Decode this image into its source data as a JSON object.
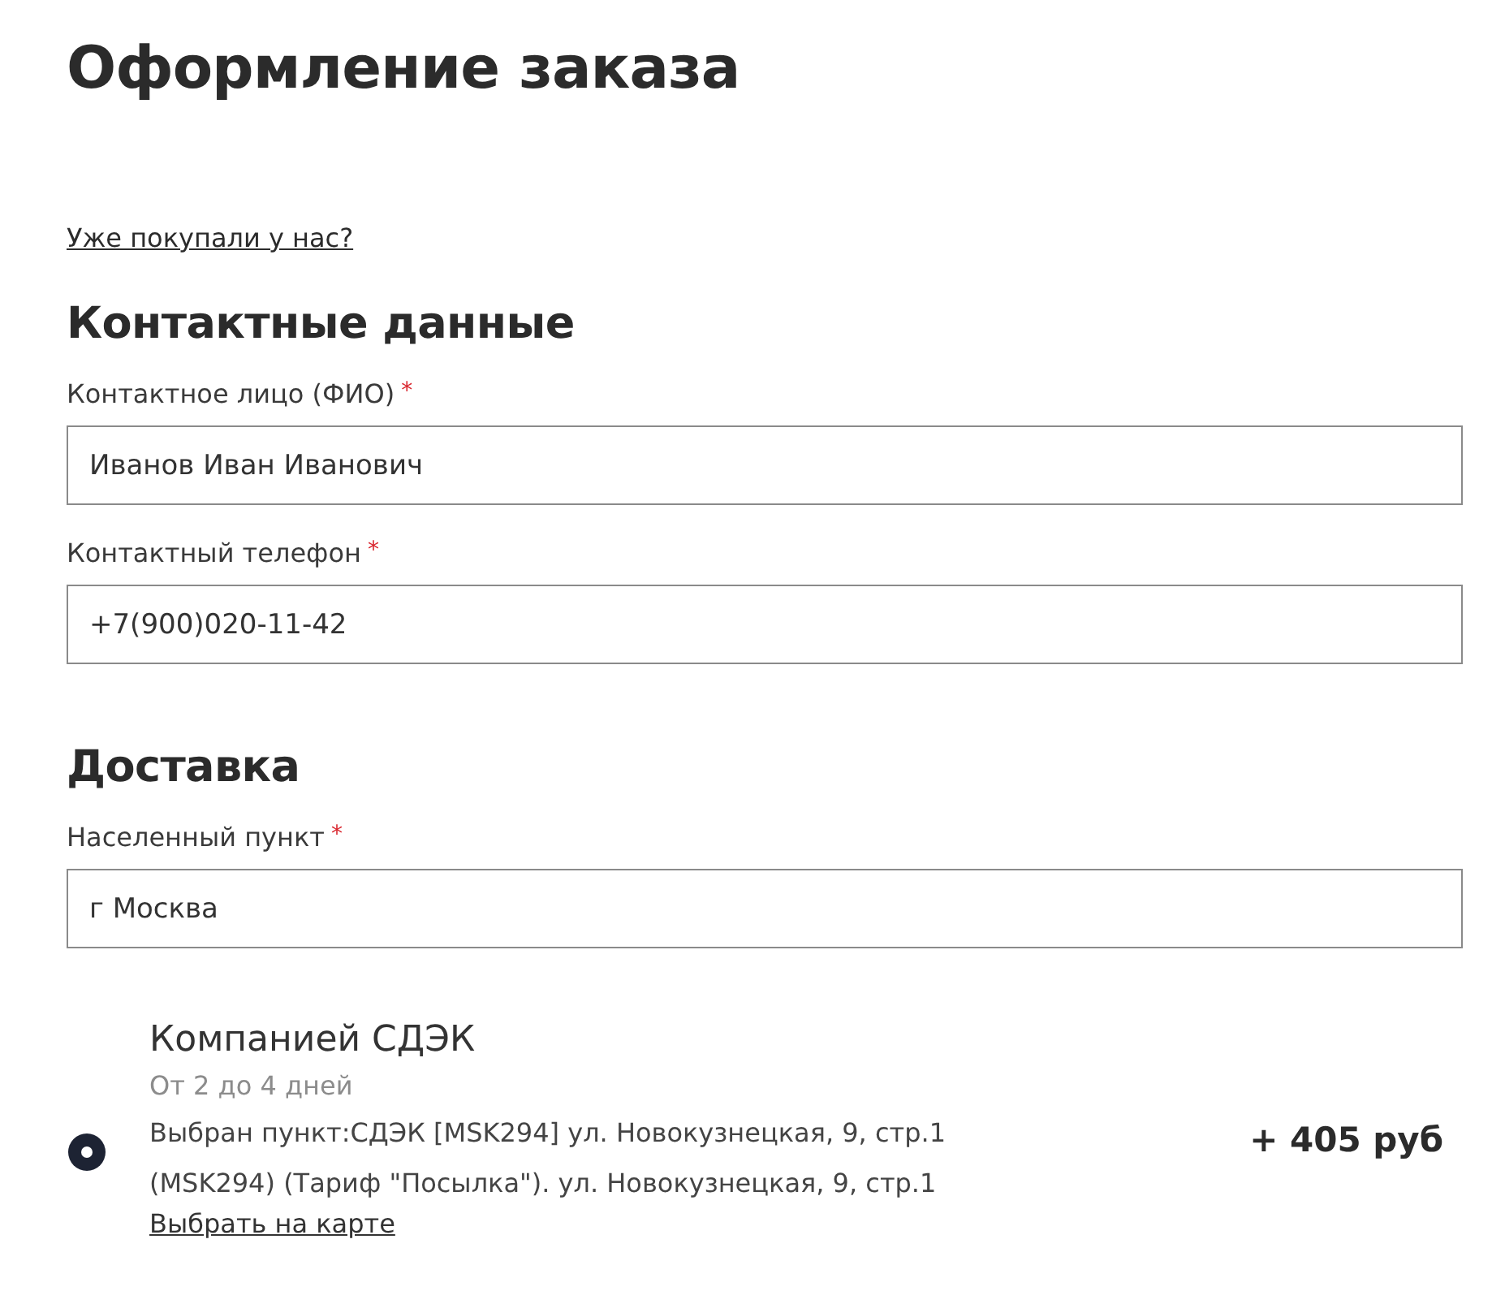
{
  "page_title": "Оформление заказа",
  "returning_customer_link": "Уже покупали у нас?",
  "sections": [
    {
      "heading": "Контактные данные",
      "fields": [
        {
          "label": "Контактное лицо (ФИО)",
          "required_mark": "*",
          "value": "Иванов Иван Иванович"
        },
        {
          "label": "Контактный телефон",
          "required_mark": "*",
          "value": "+7(900)020-11-42"
        }
      ]
    },
    {
      "heading": "Доставка",
      "fields": [
        {
          "label": "Населенный пункт",
          "required_mark": "*",
          "value": "г Москва"
        }
      ]
    }
  ],
  "delivery_options": [
    {
      "title": "Компанией СДЭК",
      "duration": "От 2 до 4 дней",
      "details": "Выбран пункт:СДЭК [MSK294] ул. Новокузнецкая, 9, стр.1 (MSK294) (Тариф \"Посылка\"). ул. Новокузнецкая, 9, стр.1",
      "map_link": "Выбрать на карте",
      "price": "+ 405 руб",
      "selected": true
    }
  ]
}
